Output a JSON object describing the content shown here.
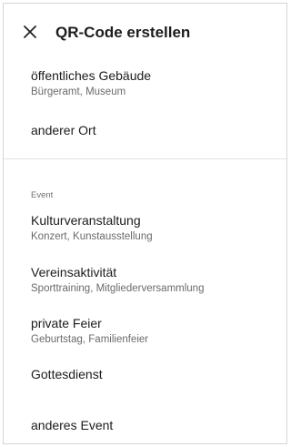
{
  "header": {
    "close_icon": "close-icon",
    "title": "QR-Code erstellen"
  },
  "places": [
    {
      "label": "öffentliches Gebäude",
      "sub": "Bürgeramt, Museum"
    },
    {
      "label": "anderer Ort",
      "sub": ""
    }
  ],
  "event_section": {
    "header": "Event",
    "items": [
      {
        "label": "Kulturveranstaltung",
        "sub": "Konzert, Kunstausstellung"
      },
      {
        "label": "Vereinsaktivität",
        "sub": "Sporttraining, Mitgliederversammlung"
      },
      {
        "label": "private Feier",
        "sub": "Geburtstag, Familienfeier"
      },
      {
        "label": "Gottesdienst",
        "sub": ""
      },
      {
        "label": "anderes Event",
        "sub": ""
      }
    ]
  }
}
